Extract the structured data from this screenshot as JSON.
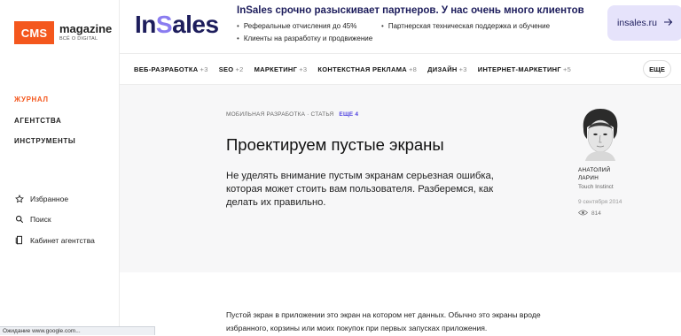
{
  "sidebar": {
    "logo": {
      "box_text": "CMS",
      "name": "magazine",
      "tagline": "ВСЁ О DIGITAL"
    },
    "main_nav": [
      {
        "label": "ЖУРНАЛ",
        "active": true
      },
      {
        "label": "АГЕНТСТВА",
        "active": false
      },
      {
        "label": "ИНСТРУМЕНТЫ",
        "active": false
      }
    ],
    "secondary_nav": [
      {
        "icon": "star-icon",
        "label": "Избранное"
      },
      {
        "icon": "search-icon",
        "label": "Поиск"
      },
      {
        "icon": "agency-cabinet-icon",
        "label": "Кабинет агентства"
      }
    ]
  },
  "banner": {
    "logo_text_before": "In",
    "logo_text_accent": "S",
    "logo_text_after": "ales",
    "headline": "InSales срочно разыскивает партнеров. У нас очень много клиентов",
    "bullets": [
      "Реферальные отчисления до 45%",
      "Партнерская техническая поддержка и обучение",
      "Клиенты на разработку и продвижение"
    ],
    "cta_label": "insales.ru",
    "cta_icon": "arrow-right-icon"
  },
  "categories": [
    {
      "label": "ВЕБ-РАЗРАБОТКА",
      "count": "+3"
    },
    {
      "label": "SEO",
      "count": "+2"
    },
    {
      "label": "МАРКЕТИНГ",
      "count": "+3"
    },
    {
      "label": "КОНТЕКСТНАЯ РЕКЛАМА",
      "count": "+8"
    },
    {
      "label": "ДИЗАЙН",
      "count": "+3"
    },
    {
      "label": "ИНТЕРНЕТ-МАРКЕТИНГ",
      "count": "+5"
    }
  ],
  "more_button": "ЕЩЕ",
  "article": {
    "meta": "МОБИЛЬНАЯ РАЗРАБОТКА · СТАТЬЯ",
    "meta_more": "ЕЩЕ 4",
    "title": "Проектируем пустые экраны",
    "lead": "Не уделять внимание пустым экранам серьезная ошибка, которая может стоить вам пользователя. Разберемся, как делать их правильно.",
    "body": "Пустой экран в приложении это экран на котором нет данных. Обычно это экраны вроде избранного, корзины или моих покупок при первых запусках приложения."
  },
  "author": {
    "name_line1": "АНАТОЛИЙ",
    "name_line2": "ЛАРИН",
    "company": "Touch Instinct",
    "date": "9 сентября 2014",
    "views": "814"
  },
  "status_bar": "Ожидание www.google.com...",
  "colors": {
    "accent": "#f4571d",
    "banner_cta_bg": "#e6e3fb",
    "brand_navy": "#1d1d5c",
    "more_link": "#4b3ee0"
  }
}
